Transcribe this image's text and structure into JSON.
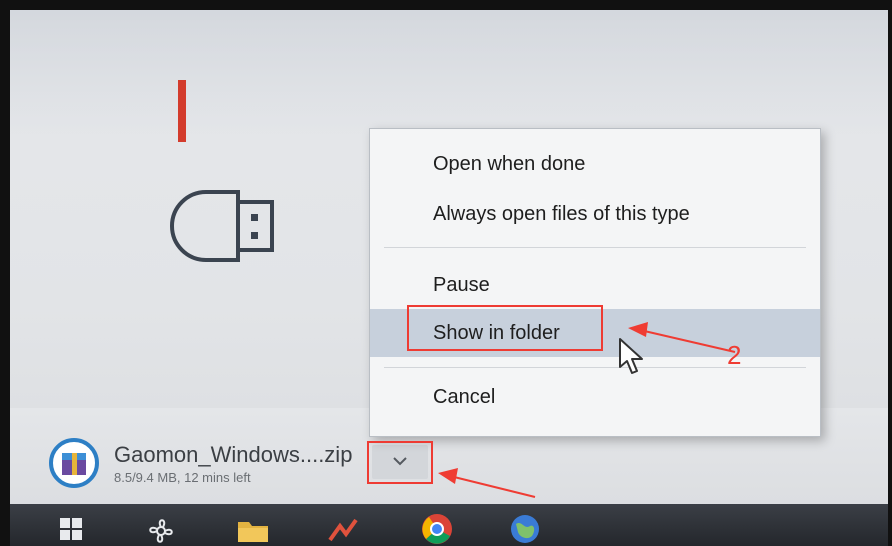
{
  "context_menu": {
    "items": [
      {
        "label": "Open when done"
      },
      {
        "label": "Always open files of this type"
      },
      {
        "label": "Pause"
      },
      {
        "label": "Show in folder",
        "highlighted": true
      },
      {
        "label": "Cancel"
      }
    ]
  },
  "download": {
    "filename": "Gaomon_Windows....zip",
    "status": "8.5/9.4 MB, 12 mins left",
    "icon": "archive-icon",
    "menu_button_icon": "chevron-down-icon"
  },
  "annotations": {
    "step1": "1",
    "step2": "2",
    "color": "#ef3c33"
  },
  "taskbar": {
    "icons": [
      "windows-start-icon",
      "fan-icon",
      "folder-icon",
      "app-icon",
      "chrome-icon",
      "globe-icon"
    ]
  }
}
